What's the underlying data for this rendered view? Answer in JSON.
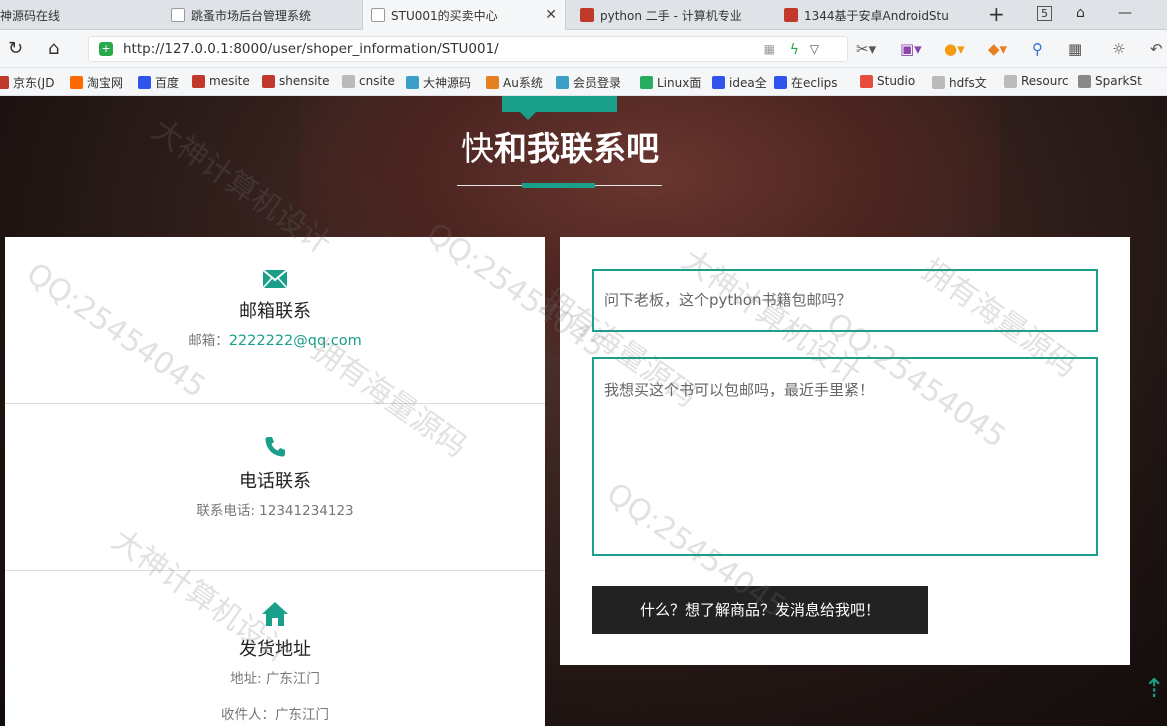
{
  "tabs": [
    {
      "label": "神源码在线",
      "fav": "#dddddd",
      "active": false
    },
    {
      "label": "跳蚤市场后台管理系统",
      "fav": "#dddddd",
      "active": false
    },
    {
      "label": "STU001的买卖中心",
      "fav": "#dddddd",
      "active": true
    },
    {
      "label": "python 二手 - 计算机专业",
      "fav": "#c0392b",
      "active": false
    },
    {
      "label": "1344基于安卓AndroidStu",
      "fav": "#c0392b",
      "active": false
    }
  ],
  "window": {
    "new_tab": "+",
    "tab_count": "5",
    "minimize": "—"
  },
  "address": {
    "url": "http://127.0.0.1:8000/user/shoper_information/STU001/"
  },
  "bookmarks": [
    {
      "label": "京东(JD",
      "color": "#c0392b"
    },
    {
      "label": "淘宝网",
      "color": "#ff6a00"
    },
    {
      "label": "百度",
      "color": "#2f54eb"
    },
    {
      "label": "mesite",
      "color": "#c0392b"
    },
    {
      "label": "shensite",
      "color": "#c0392b"
    },
    {
      "label": "cnsite",
      "color": "#bbbbbb"
    },
    {
      "label": "大神源码",
      "color": "#3aa0c8"
    },
    {
      "label": "Au系统",
      "color": "#e67e22"
    },
    {
      "label": "会员登录",
      "color": "#3aa0c8"
    },
    {
      "label": "Linux面",
      "color": "#27ae60"
    },
    {
      "label": "idea全",
      "color": "#2f54eb"
    },
    {
      "label": "在eclips",
      "color": "#2f54eb"
    },
    {
      "label": "Studio",
      "color": "#e74c3c"
    },
    {
      "label": "hdfs文",
      "color": "#bbbbbb"
    },
    {
      "label": "Resourc",
      "color": "#bbbbbb"
    },
    {
      "label": "SparkSt",
      "color": "#888888"
    }
  ],
  "page": {
    "title_light": "快",
    "title_bold": "和我联系吧"
  },
  "contact": {
    "email_title": "邮箱联系",
    "email_prefix": "邮箱：",
    "email_value": "2222222@qq.com",
    "phone_title": "电话联系",
    "phone_text": "联系电话: 12341234123",
    "address_title": "发货地址",
    "address_text": "地址: 广东江门",
    "receiver_text": "收件人：广东江门"
  },
  "form": {
    "subject_value": "问下老板，这个python书籍包邮吗？",
    "message_value": "我想买这个书可以包邮吗，最近手里紧！",
    "send_label": "什么？想了解商品？发消息给我吧！"
  },
  "watermarks": [
    "QQ:25454045",
    "大神计算机设计",
    "拥有海量源码",
    "QQ:25454045",
    "拥有海量源码",
    "大神计算机设计",
    "QQ:25454045",
    "拥有海量源码",
    "大神计算机设计",
    "QQ:25454045"
  ],
  "colors": {
    "accent": "#1aa08a",
    "button_dark": "#222222"
  }
}
